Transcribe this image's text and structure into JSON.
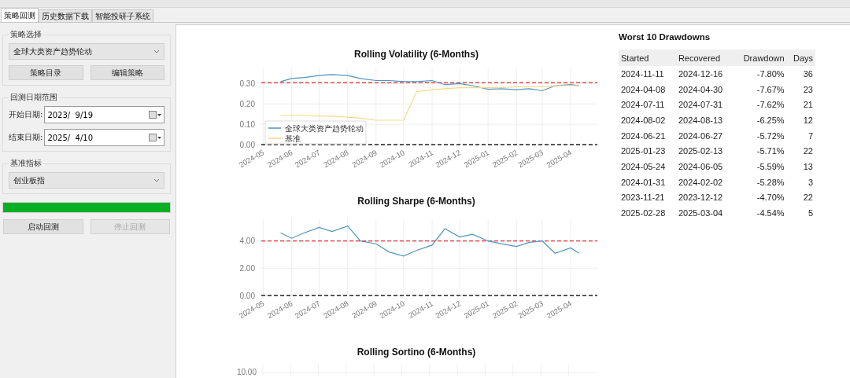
{
  "tabs": [
    {
      "label": "策略回测",
      "selected": true
    },
    {
      "label": "历史数据下载",
      "selected": false
    },
    {
      "label": "智能投研子系统",
      "selected": false
    }
  ],
  "strategy_group": {
    "title": "策略选择",
    "combo": "全球大类资产趋势轮动",
    "buttons": [
      {
        "label": "策略目录",
        "disabled": false
      },
      {
        "label": "编辑策略",
        "disabled": false
      }
    ]
  },
  "date_group": {
    "title": "回测日期范围",
    "fields": [
      {
        "label": "开始日期:",
        "value": "2023/  9/19"
      },
      {
        "label": "结束日期:",
        "value": "2025/  4/10"
      }
    ]
  },
  "benchmark_group": {
    "title": "基准指标",
    "combo": "创业板指"
  },
  "progress": {
    "level": 1
  },
  "run_buttons": [
    {
      "label": "启动回测",
      "disabled": false
    },
    {
      "label": "停止回测",
      "disabled": true
    }
  ],
  "charts": [
    {
      "chart_data": {
        "type": "line",
        "title": "Rolling Volatility (6-Months)",
        "x": [
          "2024-05-20",
          "2024-06-01",
          "2024-06-15",
          "2024-07-01",
          "2024-07-15",
          "2024-08-01",
          "2024-08-15",
          "2024-09-01",
          "2024-09-15",
          "2024-10-01",
          "2024-10-15",
          "2024-11-01",
          "2024-11-15",
          "2024-12-01",
          "2024-12-15",
          "2025-01-01",
          "2025-01-15",
          "2025-02-01",
          "2025-02-15",
          "2025-03-01",
          "2025-03-15",
          "2025-04-01",
          "2025-04-10"
        ],
        "xticks": [
          {
            "value": "2024-05-01",
            "label": "2024-05"
          },
          {
            "value": "2024-06-01",
            "label": "2024-06"
          },
          {
            "value": "2024-07-01",
            "label": "2024-07"
          },
          {
            "value": "2024-08-01",
            "label": "2024-08"
          },
          {
            "value": "2024-09-01",
            "label": "2024-09"
          },
          {
            "value": "2024-10-01",
            "label": "2024-10"
          },
          {
            "value": "2024-11-01",
            "label": "2024-11"
          },
          {
            "value": "2024-12-01",
            "label": "2024-12"
          },
          {
            "value": "2025-01-01",
            "label": "2025-01"
          },
          {
            "value": "2025-02-01",
            "label": "2025-02"
          },
          {
            "value": "2025-03-01",
            "label": "2025-03"
          },
          {
            "value": "2025-04-01",
            "label": "2025-04"
          }
        ],
        "ylim": [
          0,
          0.375
        ],
        "yticks": [
          {
            "value": 0,
            "label": "0.00"
          },
          {
            "value": 0.1,
            "label": "0.10"
          },
          {
            "value": 0.2,
            "label": "0.20"
          },
          {
            "value": 0.3,
            "label": "0.30"
          }
        ],
        "series": [
          {
            "name": "全球大类资产趋势轮动",
            "color": "#4f94c0",
            "values": [
              0.31,
              0.325,
              0.33,
              0.34,
              0.345,
              0.34,
              0.325,
              0.315,
              0.315,
              0.31,
              0.31,
              0.315,
              0.295,
              0.3,
              0.29,
              0.272,
              0.275,
              0.27,
              0.275,
              0.265,
              0.29,
              0.295,
              0.29
            ]
          },
          {
            "name": "基准",
            "color": "#f7d98a",
            "values": [
              0.145,
              0.145,
              0.145,
              0.14,
              0.14,
              0.135,
              0.13,
              0.12,
              0.12,
              0.12,
              0.26,
              0.27,
              0.275,
              0.28,
              0.28,
              0.28,
              0.28,
              0.285,
              0.285,
              0.285,
              0.29,
              0.29,
              0.29
            ]
          }
        ],
        "legend": true,
        "xlim": [
          "2024-04-29",
          "2025-04-30"
        ],
        "grid": true,
        "ref_lines": [
          {
            "axis": "y",
            "value": 0.305,
            "color": "#e0282e"
          },
          {
            "axis": "y",
            "value": 0,
            "color": "#222222"
          }
        ]
      }
    },
    {
      "chart_data": {
        "type": "line",
        "title": "Rolling Sharpe (6-Months)",
        "x": [
          "2024-05-20",
          "2024-06-01",
          "2024-06-15",
          "2024-07-01",
          "2024-07-15",
          "2024-08-01",
          "2024-08-15",
          "2024-09-01",
          "2024-09-15",
          "2024-10-01",
          "2024-10-15",
          "2024-11-01",
          "2024-11-15",
          "2024-12-01",
          "2024-12-15",
          "2025-01-01",
          "2025-01-15",
          "2025-02-01",
          "2025-02-15",
          "2025-03-01",
          "2025-03-15",
          "2025-04-01",
          "2025-04-10"
        ],
        "xticks": [
          {
            "value": "2024-05-01",
            "label": "2024-05"
          },
          {
            "value": "2024-06-01",
            "label": "2024-06"
          },
          {
            "value": "2024-07-01",
            "label": "2024-07"
          },
          {
            "value": "2024-08-01",
            "label": "2024-08"
          },
          {
            "value": "2024-09-01",
            "label": "2024-09"
          },
          {
            "value": "2024-10-01",
            "label": "2024-10"
          },
          {
            "value": "2024-11-01",
            "label": "2024-11"
          },
          {
            "value": "2024-12-01",
            "label": "2024-12"
          },
          {
            "value": "2025-01-01",
            "label": "2025-01"
          },
          {
            "value": "2025-02-01",
            "label": "2025-02"
          },
          {
            "value": "2025-03-01",
            "label": "2025-03"
          },
          {
            "value": "2025-04-01",
            "label": "2025-04"
          }
        ],
        "ylim": [
          0,
          5.6
        ],
        "yticks": [
          {
            "value": 0,
            "label": "0.00"
          },
          {
            "value": 2,
            "label": "2.00"
          },
          {
            "value": 4,
            "label": "4.00"
          }
        ],
        "series": [
          {
            "color": "#4f94c0",
            "values": [
              4.6,
              4.2,
              4.6,
              5.0,
              4.7,
              5.1,
              4.0,
              3.8,
              3.2,
              2.9,
              3.3,
              3.7,
              4.9,
              4.3,
              4.5,
              4.0,
              3.8,
              3.6,
              3.9,
              4.0,
              3.1,
              3.5,
              3.1
            ]
          }
        ],
        "legend": false,
        "xlim": [
          "2024-04-29",
          "2025-04-30"
        ],
        "grid": true,
        "ref_lines": [
          {
            "axis": "y",
            "value": 4.0,
            "color": "#e0282e"
          },
          {
            "axis": "y",
            "value": 0,
            "color": "#222222"
          }
        ]
      }
    },
    {
      "title": "Rolling Sortino (6-Months)",
      "top_tick_label": "10.00"
    }
  ],
  "drawdowns": {
    "title": "Worst 10 Drawdowns",
    "columns": [
      "Started",
      "Recovered",
      "Drawdown",
      "Days"
    ],
    "rows": [
      [
        "2024-11-11",
        "2024-12-16",
        "-7.80%",
        "36"
      ],
      [
        "2024-04-08",
        "2024-04-30",
        "-7.67%",
        "23"
      ],
      [
        "2024-07-11",
        "2024-07-31",
        "-7.62%",
        "21"
      ],
      [
        "2024-08-02",
        "2024-08-13",
        "-6.25%",
        "12"
      ],
      [
        "2024-06-21",
        "2024-06-27",
        "-5.72%",
        "7"
      ],
      [
        "2025-01-23",
        "2025-02-13",
        "-5.71%",
        "22"
      ],
      [
        "2024-05-24",
        "2024-06-05",
        "-5.59%",
        "13"
      ],
      [
        "2024-01-31",
        "2024-02-02",
        "-5.28%",
        "3"
      ],
      [
        "2023-11-21",
        "2023-12-12",
        "-4.70%",
        "22"
      ],
      [
        "2025-02-28",
        "2025-03-04",
        "-4.54%",
        "5"
      ]
    ]
  }
}
